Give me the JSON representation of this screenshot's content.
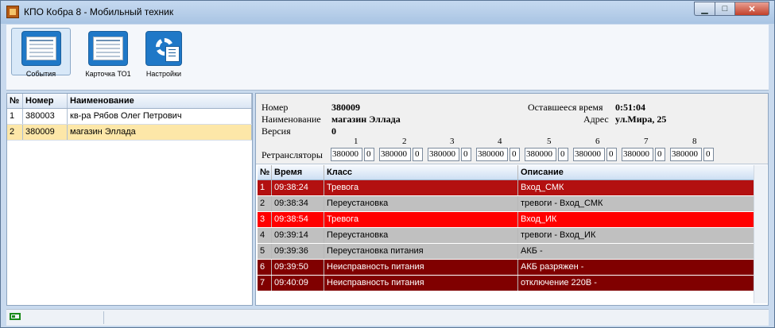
{
  "window": {
    "title": "КПО Кобра 8 - Мобильный техник"
  },
  "toolbar": {
    "events_label": "События",
    "card_label": "Карточка ТО1",
    "settings_label": "Настройки"
  },
  "objects": {
    "columns": [
      "№",
      "Номер",
      "Наименование"
    ],
    "rows": [
      {
        "n": "1",
        "number": "380003",
        "name": "кв-ра Рябов Олег Петрович",
        "selected": false
      },
      {
        "n": "2",
        "number": "380009",
        "name": "магазин Эллада",
        "selected": true
      }
    ]
  },
  "details": {
    "number_label": "Номер",
    "number_value": "380009",
    "name_label": "Наименование",
    "name_value": "магазин Эллада",
    "version_label": "Версия",
    "version_value": "0",
    "remaining_label": "Оставшееся время",
    "remaining_value": "0:51:04",
    "address_label": "Адрес",
    "address_value": "ул.Мира, 25",
    "repeaters_label": "Ретрансляторы",
    "repeater_numbers": [
      "1",
      "2",
      "3",
      "4",
      "5",
      "6",
      "7",
      "8"
    ],
    "repeater_values": [
      "380000",
      "380000",
      "380000",
      "380000",
      "380000",
      "380000",
      "380000",
      "380000"
    ],
    "repeater_flags": [
      "0",
      "0",
      "0",
      "0",
      "0",
      "0",
      "0",
      "0"
    ]
  },
  "events": {
    "columns": [
      "№",
      "Время",
      "Класс",
      "Описание"
    ],
    "rows": [
      {
        "n": "1",
        "time": "09:38:24",
        "cls": "Тревога",
        "desc": "Вход_СМК",
        "bg": "#b31010",
        "fg": "#ffffff"
      },
      {
        "n": "2",
        "time": "09:38:34",
        "cls": "Переустановка",
        "desc": "тревоги  - Вход_СМК",
        "bg": "#c0c0c0",
        "fg": "#000000"
      },
      {
        "n": "3",
        "time": "09:38:54",
        "cls": "Тревога",
        "desc": "Вход_ИК",
        "bg": "#ff0000",
        "fg": "#ffffff"
      },
      {
        "n": "4",
        "time": "09:39:14",
        "cls": "Переустановка",
        "desc": "тревоги  - Вход_ИК",
        "bg": "#c0c0c0",
        "fg": "#000000"
      },
      {
        "n": "5",
        "time": "09:39:36",
        "cls": "Переустановка питания",
        "desc": "АКБ -",
        "bg": "#c0c0c0",
        "fg": "#000000"
      },
      {
        "n": "6",
        "time": "09:39:50",
        "cls": "Неисправность питания",
        "desc": "АКБ разряжен -",
        "bg": "#800000",
        "fg": "#ffffff"
      },
      {
        "n": "7",
        "time": "09:40:09",
        "cls": "Неисправность питания",
        "desc": "отключение 220В -",
        "bg": "#800000",
        "fg": "#ffffff"
      }
    ]
  }
}
